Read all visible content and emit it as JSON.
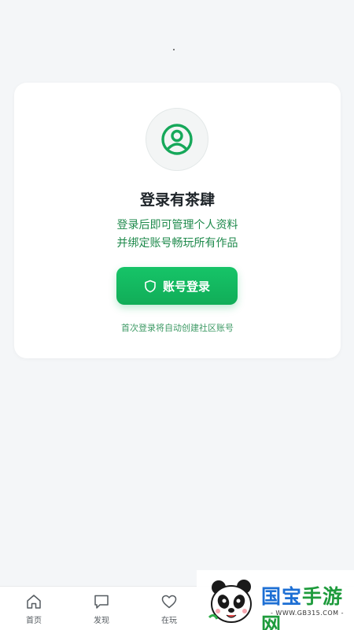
{
  "card": {
    "title": "登录有茶肆",
    "description_line1": "登录后即可管理个人资料",
    "description_line2": "并绑定账号畅玩所有作品",
    "login_button_label": "账号登录",
    "hint": "首次登录将自动创建社区账号"
  },
  "tabbar": {
    "items": [
      {
        "label": "首页",
        "icon": "home-icon"
      },
      {
        "label": "发现",
        "icon": "chat-icon"
      },
      {
        "label": "在玩",
        "icon": "heart-icon"
      }
    ]
  },
  "watermark": {
    "brand_part1": "国宝",
    "brand_part2": "手游网",
    "url": "- WWW.GB315.COM -"
  },
  "colors": {
    "accent": "#16c468",
    "accent_text": "#1f8a4c",
    "background": "#f4f6f8"
  }
}
